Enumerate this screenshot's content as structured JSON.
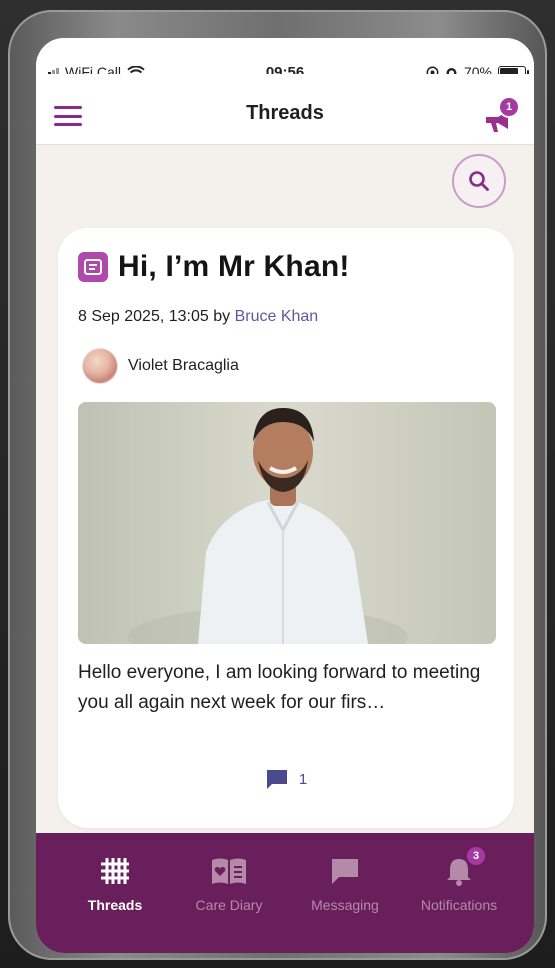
{
  "status_bar": {
    "carrier": "WiFi Call",
    "time": "09:56",
    "battery": "70%"
  },
  "header": {
    "title": "Threads",
    "announcements_badge": "1"
  },
  "post": {
    "title": "Hi, I’m Mr Khan!",
    "date": "8 Sep 2025, 13:05 by",
    "author": "Bruce Khan",
    "child_name": "Violet Bracaglia",
    "body": "Hello everyone,  I am looking forward to meeting you all again next week for our firs…",
    "comment_count": "1"
  },
  "tabbar": {
    "tabs": [
      {
        "label": "Threads",
        "active": true
      },
      {
        "label": "Care Diary",
        "active": false
      },
      {
        "label": "Messaging",
        "active": false
      },
      {
        "label": "Notifications",
        "active": false
      }
    ],
    "notifications_badge": "3"
  },
  "colors": {
    "brand_purple": "#8a2b87",
    "tabbar_bg": "#6a1f5d",
    "badge": "#a53aa1",
    "link": "#5b5aa0"
  }
}
